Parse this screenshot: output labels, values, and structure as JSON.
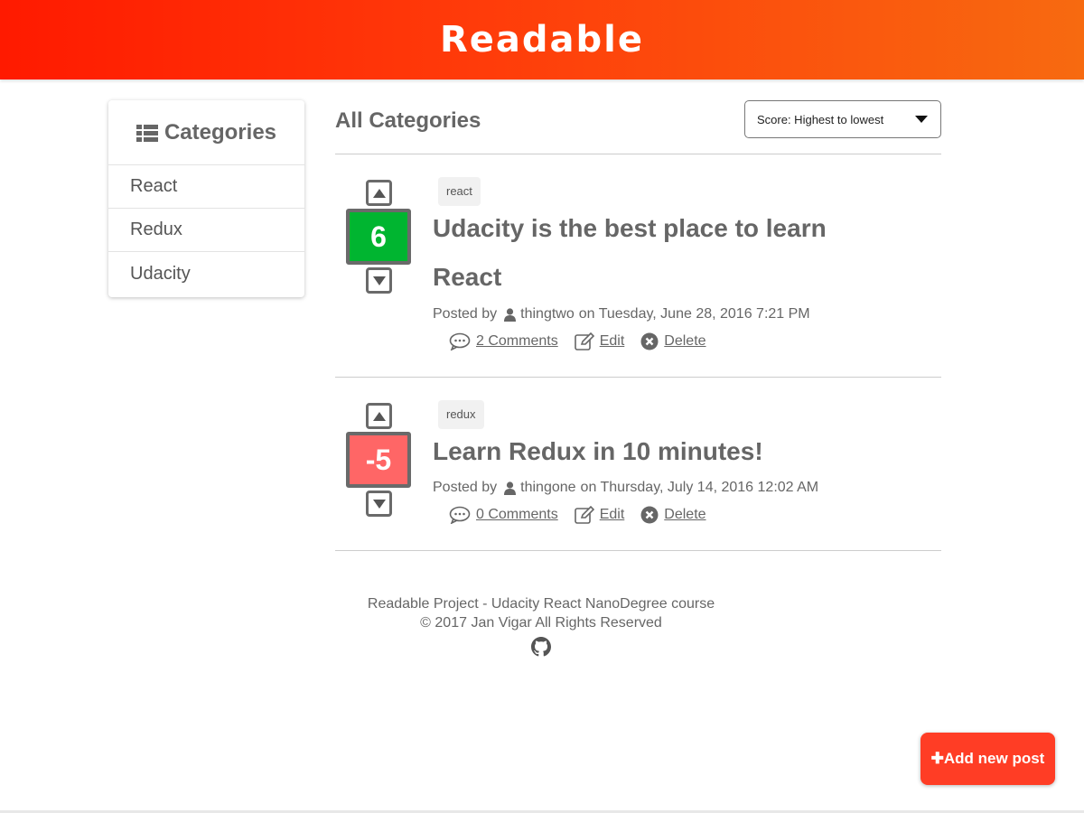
{
  "header": {
    "title": "Readable"
  },
  "sidebar": {
    "title": "Categories",
    "title_icon": "list-icon",
    "items": [
      {
        "label": "React"
      },
      {
        "label": "Redux"
      },
      {
        "label": "Udacity"
      }
    ]
  },
  "main": {
    "title": "All Categories",
    "sort": {
      "selected": "Score: Highest to lowest"
    }
  },
  "posts": [
    {
      "category": "react",
      "score": "6",
      "score_color": "#00b530",
      "title": "Udacity is the best place to learn React",
      "posted_by_prefix": "Posted by",
      "author": "thingtwo",
      "date": "on Tuesday, June 28, 2016 7:21 PM",
      "comments": "2 Comments",
      "edit": "Edit",
      "delete": "Delete"
    },
    {
      "category": "redux",
      "score": "-5",
      "score_color": "#ff6666",
      "title": "Learn Redux in 10 minutes!",
      "posted_by_prefix": "Posted by",
      "author": "thingone",
      "date": "on Thursday, July 14, 2016 12:02 AM",
      "comments": "0 Comments",
      "edit": "Edit",
      "delete": "Delete"
    }
  ],
  "footer": {
    "line1": "Readable Project - Udacity React NanoDegree course",
    "line2": "© 2017 Jan Vigar All Rights Reserved",
    "icon": "github-icon"
  },
  "add_button": {
    "label": "✚Add new post"
  },
  "colors": {
    "header_start": "#ff1a00",
    "header_end": "#f76a10",
    "positive_score": "#00b530",
    "negative_score": "#ff6666",
    "add_button": "#ff3d25"
  }
}
